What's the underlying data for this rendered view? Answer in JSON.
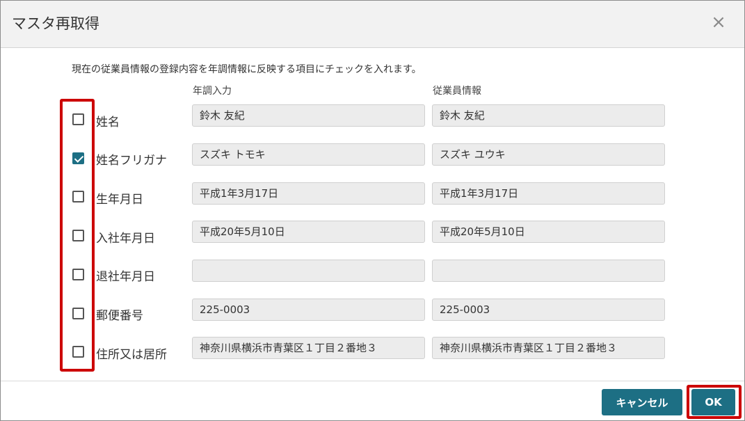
{
  "dialog": {
    "title": "マスタ再取得",
    "close_glyph": "×",
    "description": "現在の従業員情報の登録内容を年調情報に反映する項目にチェックを入れます。",
    "columns": {
      "nencho": "年調入力",
      "employee": "従業員情報"
    },
    "rows": [
      {
        "label": "姓名",
        "checked": false,
        "nencho": "鈴木 友紀",
        "employee": "鈴木 友紀"
      },
      {
        "label": "姓名フリガナ",
        "checked": true,
        "nencho": "スズキ トモキ",
        "employee": "スズキ ユウキ"
      },
      {
        "label": "生年月日",
        "checked": false,
        "nencho": "平成1年3月17日",
        "employee": "平成1年3月17日"
      },
      {
        "label": "入社年月日",
        "checked": false,
        "nencho": "平成20年5月10日",
        "employee": "平成20年5月10日"
      },
      {
        "label": "退社年月日",
        "checked": false,
        "nencho": "",
        "employee": ""
      },
      {
        "label": "郵便番号",
        "checked": false,
        "nencho": "225-0003",
        "employee": "225-0003"
      },
      {
        "label": "住所又は居所",
        "checked": false,
        "nencho": "神奈川県横浜市青葉区１丁目２番地３",
        "employee": "神奈川県横浜市青葉区１丁目２番地３"
      }
    ],
    "buttons": {
      "cancel": "キャンセル",
      "ok": "OK"
    },
    "colors": {
      "accent": "#1d6f84",
      "highlight": "#cc0000"
    }
  }
}
